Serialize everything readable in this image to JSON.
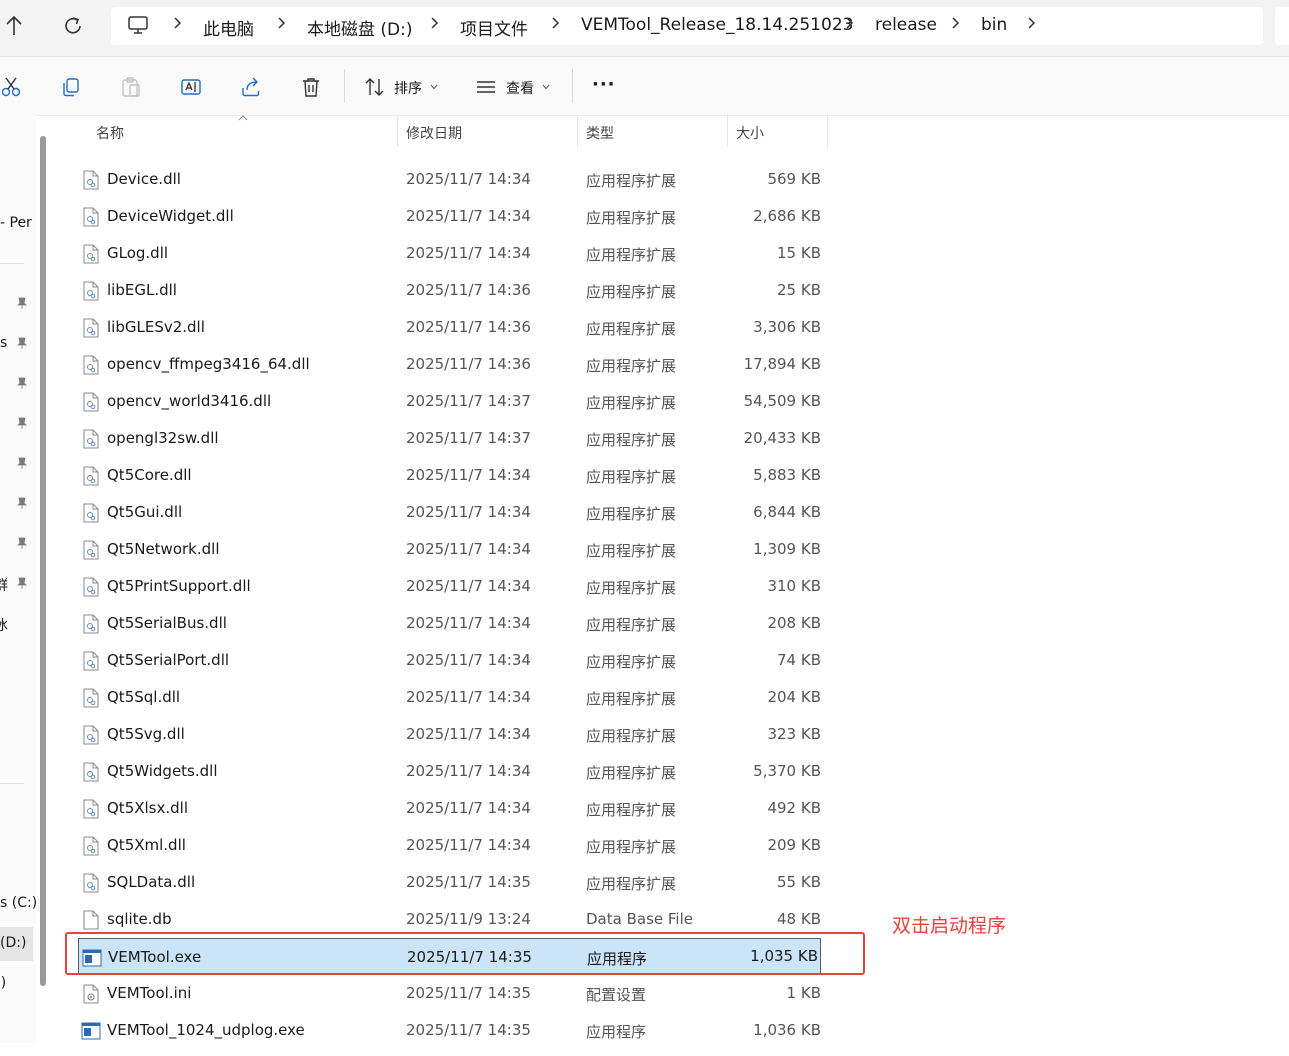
{
  "address_bar": {
    "crumbs": [
      "此电脑",
      "本地磁盘 (D:)",
      "项目文件",
      "VEMTool_Release_18.14.251023",
      "release",
      "bin"
    ]
  },
  "toolbar": {
    "sort_label": "排序",
    "view_label": "查看",
    "more_label": "···"
  },
  "nav": {
    "fragments": [
      "- Per",
      "s",
      "群",
      "冰",
      "s (C:)",
      "(D:)",
      ":)"
    ]
  },
  "columns": {
    "name": "名称",
    "date": "修改日期",
    "type": "类型",
    "size": "大小"
  },
  "files": [
    {
      "name": "Device.dll",
      "date": "2025/11/7 14:34",
      "type": "应用程序扩展",
      "size": "569 KB",
      "kind": "dll"
    },
    {
      "name": "DeviceWidget.dll",
      "date": "2025/11/7 14:34",
      "type": "应用程序扩展",
      "size": "2,686 KB",
      "kind": "dll"
    },
    {
      "name": "GLog.dll",
      "date": "2025/11/7 14:34",
      "type": "应用程序扩展",
      "size": "15 KB",
      "kind": "dll"
    },
    {
      "name": "libEGL.dll",
      "date": "2025/11/7 14:36",
      "type": "应用程序扩展",
      "size": "25 KB",
      "kind": "dll"
    },
    {
      "name": "libGLESv2.dll",
      "date": "2025/11/7 14:36",
      "type": "应用程序扩展",
      "size": "3,306 KB",
      "kind": "dll"
    },
    {
      "name": "opencv_ffmpeg3416_64.dll",
      "date": "2025/11/7 14:36",
      "type": "应用程序扩展",
      "size": "17,894 KB",
      "kind": "dll"
    },
    {
      "name": "opencv_world3416.dll",
      "date": "2025/11/7 14:37",
      "type": "应用程序扩展",
      "size": "54,509 KB",
      "kind": "dll"
    },
    {
      "name": "opengl32sw.dll",
      "date": "2025/11/7 14:37",
      "type": "应用程序扩展",
      "size": "20,433 KB",
      "kind": "dll"
    },
    {
      "name": "Qt5Core.dll",
      "date": "2025/11/7 14:34",
      "type": "应用程序扩展",
      "size": "5,883 KB",
      "kind": "dll"
    },
    {
      "name": "Qt5Gui.dll",
      "date": "2025/11/7 14:34",
      "type": "应用程序扩展",
      "size": "6,844 KB",
      "kind": "dll"
    },
    {
      "name": "Qt5Network.dll",
      "date": "2025/11/7 14:34",
      "type": "应用程序扩展",
      "size": "1,309 KB",
      "kind": "dll"
    },
    {
      "name": "Qt5PrintSupport.dll",
      "date": "2025/11/7 14:34",
      "type": "应用程序扩展",
      "size": "310 KB",
      "kind": "dll"
    },
    {
      "name": "Qt5SerialBus.dll",
      "date": "2025/11/7 14:34",
      "type": "应用程序扩展",
      "size": "208 KB",
      "kind": "dll"
    },
    {
      "name": "Qt5SerialPort.dll",
      "date": "2025/11/7 14:34",
      "type": "应用程序扩展",
      "size": "74 KB",
      "kind": "dll"
    },
    {
      "name": "Qt5Sql.dll",
      "date": "2025/11/7 14:34",
      "type": "应用程序扩展",
      "size": "204 KB",
      "kind": "dll"
    },
    {
      "name": "Qt5Svg.dll",
      "date": "2025/11/7 14:34",
      "type": "应用程序扩展",
      "size": "323 KB",
      "kind": "dll"
    },
    {
      "name": "Qt5Widgets.dll",
      "date": "2025/11/7 14:34",
      "type": "应用程序扩展",
      "size": "5,370 KB",
      "kind": "dll"
    },
    {
      "name": "Qt5Xlsx.dll",
      "date": "2025/11/7 14:34",
      "type": "应用程序扩展",
      "size": "492 KB",
      "kind": "dll"
    },
    {
      "name": "Qt5Xml.dll",
      "date": "2025/11/7 14:34",
      "type": "应用程序扩展",
      "size": "209 KB",
      "kind": "dll"
    },
    {
      "name": "SQLData.dll",
      "date": "2025/11/7 14:35",
      "type": "应用程序扩展",
      "size": "55 KB",
      "kind": "dll"
    },
    {
      "name": "sqlite.db",
      "date": "2025/11/9 13:24",
      "type": "Data Base File",
      "size": "48 KB",
      "kind": "file"
    },
    {
      "name": "VEMTool.exe",
      "date": "2025/11/7 14:35",
      "type": "应用程序",
      "size": "1,035 KB",
      "kind": "exe",
      "selected": true
    },
    {
      "name": "VEMTool.ini",
      "date": "2025/11/7 14:35",
      "type": "配置设置",
      "size": "1 KB",
      "kind": "ini"
    },
    {
      "name": "VEMTool_1024_udplog.exe",
      "date": "2025/11/7 14:35",
      "type": "应用程序",
      "size": "1,036 KB",
      "kind": "exe"
    }
  ],
  "annotation": {
    "text": "双击启动程序",
    "color": "#e8413e"
  },
  "colors": {
    "selection": "#cce4f7",
    "accent": "#0067c0"
  }
}
